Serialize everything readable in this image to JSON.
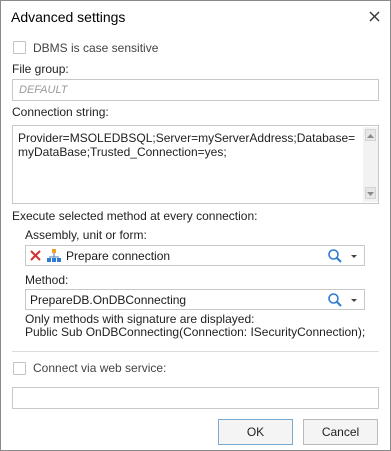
{
  "window": {
    "title": "Advanced settings"
  },
  "dbms_case": {
    "label": "DBMS is case sensitive",
    "checked": false
  },
  "file_group": {
    "label": "File group:",
    "placeholder": "DEFAULT",
    "value": ""
  },
  "connection": {
    "label": "Connection string:",
    "value": "Provider=MSOLEDBSQL;Server=myServerAddress;Database=myDataBase;Trusted_Connection=yes;"
  },
  "execute": {
    "label": "Execute selected method at every connection:",
    "assembly_label": "Assembly, unit or form:",
    "assembly_value": "Prepare connection",
    "method_label": "Method:",
    "method_value": "PrepareDB.OnDBConnecting",
    "hint_line1": "Only methods with signature are displayed:",
    "hint_line2": "Public Sub OnDBConnecting(Connection: ISecurityConnection);"
  },
  "web_service": {
    "label": "Connect via web service:",
    "checked": false,
    "value": ""
  },
  "buttons": {
    "ok": "OK",
    "cancel": "Cancel"
  },
  "icons": {
    "close": "close-icon",
    "clear": "red-x-icon",
    "unit": "unit-icon",
    "search": "search-icon",
    "dropdown": "chevron-down-icon"
  },
  "colors": {
    "accent": "#2f7bd0",
    "clear": "#d32f2f"
  }
}
